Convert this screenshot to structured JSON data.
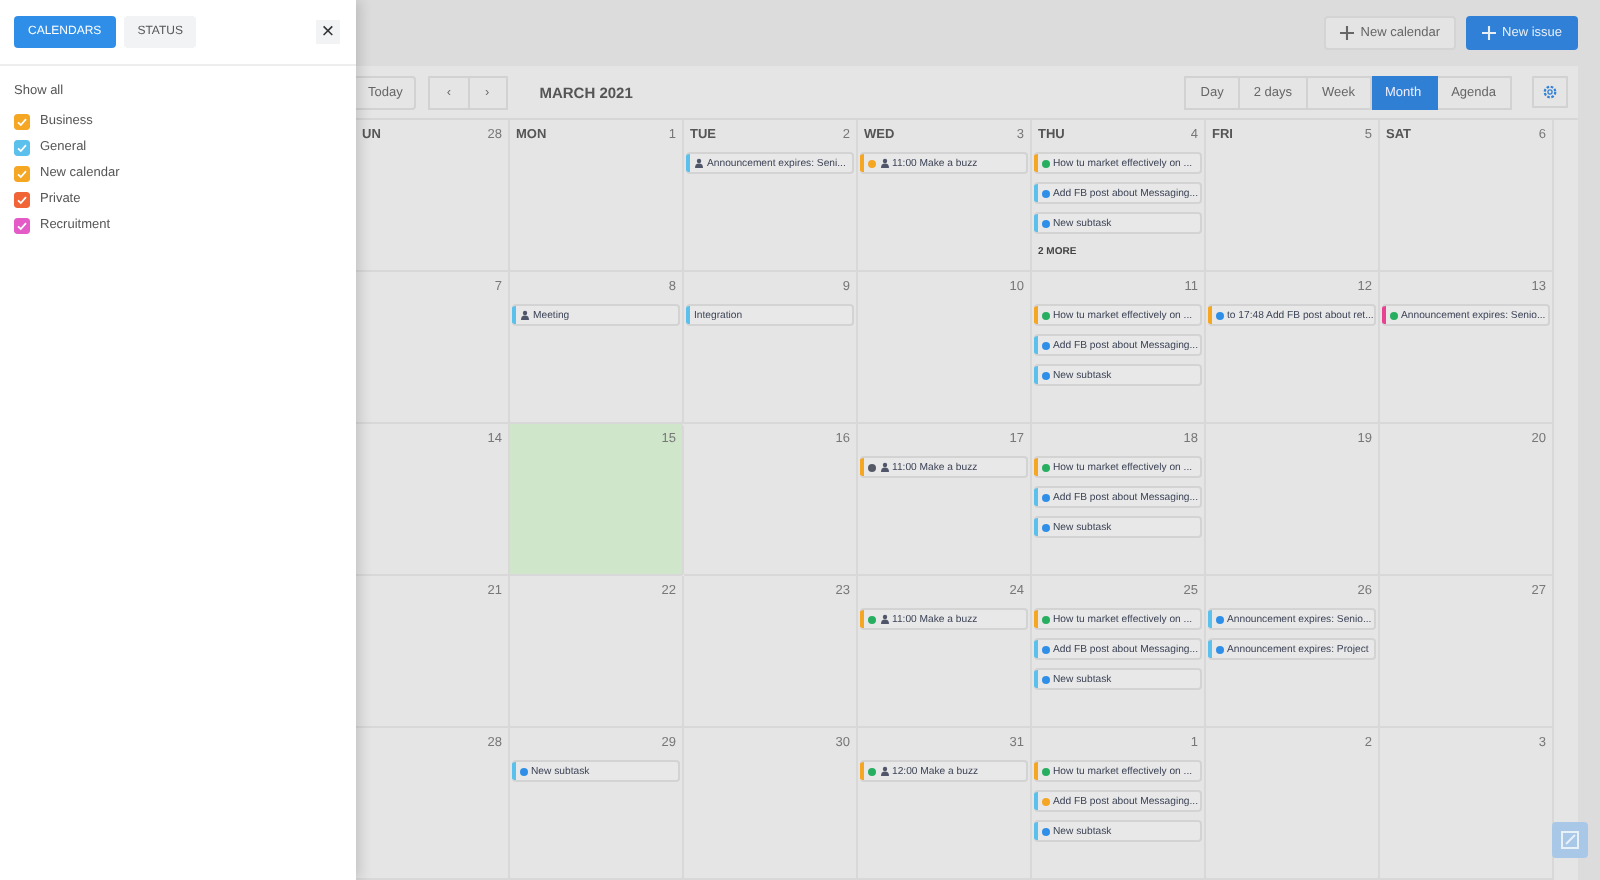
{
  "drawer": {
    "tabs": [
      {
        "label": "CALENDARS",
        "selected": true
      },
      {
        "label": "STATUS",
        "selected": false
      }
    ],
    "close": "×",
    "show_all": "Show all",
    "calendars": [
      {
        "name": "Business",
        "checked": true,
        "color": "#f5a623"
      },
      {
        "name": "General",
        "checked": true,
        "color": "#5bc0eb"
      },
      {
        "name": "New calendar",
        "checked": true,
        "color": "#f5a623"
      },
      {
        "name": "Private",
        "checked": true,
        "color": "#f06436"
      },
      {
        "name": "Recruitment",
        "checked": true,
        "color": "#e45bc8"
      }
    ]
  },
  "actions": [
    {
      "label": "New calendar",
      "kind": "secondary"
    },
    {
      "label": "New issue",
      "kind": "primary"
    }
  ],
  "toolbar": {
    "today": "Today",
    "prev": "‹",
    "next": "›",
    "month_title": "MARCH 2021",
    "views": [
      {
        "label": "Day",
        "selected": false
      },
      {
        "label": "2 days",
        "selected": false
      },
      {
        "label": "Week",
        "selected": false
      },
      {
        "label": "Month",
        "selected": true
      },
      {
        "label": "Agenda",
        "selected": false
      }
    ]
  },
  "weekdays": [
    "UN",
    "MON",
    "TUE",
    "WED",
    "THU",
    "FRI",
    "SAT"
  ],
  "weeks": [
    {
      "days": [
        {
          "number": "28",
          "today": false
        },
        {
          "number": "1",
          "today": false
        },
        {
          "number": "2",
          "today": false,
          "events": [
            {
              "text": "Announcement expires: Seni...",
              "color": "#5bc0eb",
              "person": true
            }
          ]
        },
        {
          "number": "3",
          "today": false,
          "events": [
            {
              "text": "11:00 Make a buzz",
              "color": "#f5a623",
              "dot": {
                "color": "#f5a623"
              },
              "person": true
            }
          ]
        },
        {
          "number": "4",
          "today": false,
          "more": "2 MORE",
          "events": [
            {
              "text": "How tu market effectively on ...",
              "color": "#f5a623",
              "dot": {
                "color": "#27ae60"
              },
              "person": false
            },
            {
              "text": "Add FB post about Messaging...",
              "color": "#5bc0eb",
              "dot": {
                "color": "#2f8fe8"
              },
              "person": false
            },
            {
              "text": "New subtask",
              "color": "#5bc0eb",
              "dot": {
                "color": "#2f8fe8"
              },
              "person": false
            }
          ]
        },
        {
          "number": "5",
          "today": false
        },
        {
          "number": "6",
          "today": false
        }
      ]
    },
    {
      "days": [
        {
          "number": "7",
          "today": false
        },
        {
          "number": "8",
          "today": false,
          "events": [
            {
              "text": "Meeting",
              "color": "#5bc0eb",
              "person": true
            }
          ]
        },
        {
          "number": "9",
          "today": false,
          "events": [
            {
              "text": "Integration",
              "color": "#5bc0eb",
              "person": false
            }
          ]
        },
        {
          "number": "10",
          "today": false
        },
        {
          "number": "11",
          "today": false,
          "events": [
            {
              "text": "How tu market effectively on ...",
              "color": "#f5a623",
              "dot": {
                "color": "#27ae60"
              },
              "person": false
            },
            {
              "text": "Add FB post about Messaging...",
              "color": "#5bc0eb",
              "dot": {
                "color": "#2f8fe8"
              },
              "person": false
            },
            {
              "text": "New subtask",
              "color": "#5bc0eb",
              "dot": {
                "color": "#2f8fe8"
              },
              "person": false
            }
          ]
        },
        {
          "number": "12",
          "today": false,
          "events": [
            {
              "text": "to 17:48  Add FB post about ret...",
              "color": "#f5a623",
              "dot": {
                "color": "#2f8fe8"
              },
              "person": false
            }
          ]
        },
        {
          "number": "13",
          "today": false,
          "events": [
            {
              "text": "Announcement expires: Senio...",
              "color": "#e84393",
              "dot": {
                "color": "#27ae60"
              },
              "person": false
            }
          ]
        }
      ]
    },
    {
      "days": [
        {
          "number": "14",
          "today": false
        },
        {
          "number": "15",
          "today": true
        },
        {
          "number": "16",
          "today": false
        },
        {
          "number": "17",
          "today": false,
          "events": [
            {
              "text": "11:00 Make a buzz",
              "color": "#f5a623",
              "dot": {
                "color": "#555a66"
              },
              "person": true
            }
          ]
        },
        {
          "number": "18",
          "today": false,
          "events": [
            {
              "text": "How tu market effectively on ...",
              "color": "#f5a623",
              "dot": {
                "color": "#27ae60"
              },
              "person": false
            },
            {
              "text": "Add FB post about Messaging...",
              "color": "#5bc0eb",
              "dot": {
                "color": "#2f8fe8"
              },
              "person": false
            },
            {
              "text": "New subtask",
              "color": "#5bc0eb",
              "dot": {
                "color": "#2f8fe8"
              },
              "person": false
            }
          ]
        },
        {
          "number": "19",
          "today": false
        },
        {
          "number": "20",
          "today": false
        }
      ]
    },
    {
      "days": [
        {
          "number": "21",
          "today": false
        },
        {
          "number": "22",
          "today": false
        },
        {
          "number": "23",
          "today": false
        },
        {
          "number": "24",
          "today": false,
          "events": [
            {
              "text": "11:00 Make a buzz",
              "color": "#f5a623",
              "dot": {
                "color": "#27ae60"
              },
              "person": true
            }
          ]
        },
        {
          "number": "25",
          "today": false,
          "events": [
            {
              "text": "How tu market effectively on ...",
              "color": "#f5a623",
              "dot": {
                "color": "#27ae60"
              },
              "person": false
            },
            {
              "text": "Add FB post about Messaging...",
              "color": "#5bc0eb",
              "dot": {
                "color": "#2f8fe8"
              },
              "person": false
            },
            {
              "text": "New subtask",
              "color": "#5bc0eb",
              "dot": {
                "color": "#2f8fe8"
              },
              "person": false
            }
          ]
        },
        {
          "number": "26",
          "today": false,
          "events": [
            {
              "text": "Announcement expires: Senio...",
              "color": "#5bc0eb",
              "dot": {
                "color": "#2f8fe8"
              },
              "person": false
            },
            {
              "text": "Announcement expires: Project",
              "color": "#5bc0eb",
              "dot": {
                "color": "#2f8fe8"
              },
              "person": false
            }
          ]
        },
        {
          "number": "27",
          "today": false
        }
      ]
    },
    {
      "days": [
        {
          "number": "28",
          "today": false
        },
        {
          "number": "29",
          "today": false,
          "events": [
            {
              "text": "New subtask",
              "color": "#5bc0eb",
              "dot": {
                "color": "#2f8fe8"
              },
              "person": false
            }
          ]
        },
        {
          "number": "30",
          "today": false
        },
        {
          "number": "31",
          "today": false,
          "events": [
            {
              "text": "12:00 Make a buzz",
              "color": "#f5a623",
              "dot": {
                "color": "#27ae60"
              },
              "person": true
            }
          ]
        },
        {
          "number": "1",
          "today": false,
          "events": [
            {
              "text": "How tu market effectively on ...",
              "color": "#f5a623",
              "dot": {
                "color": "#27ae60"
              },
              "person": false
            },
            {
              "text": "Add FB post about Messaging...",
              "color": "#5bc0eb",
              "dot": {
                "color": "#f5a623"
              },
              "person": false
            },
            {
              "text": "New subtask",
              "color": "#5bc0eb",
              "dot": {
                "color": "#2f8fe8"
              },
              "person": false
            }
          ]
        },
        {
          "number": "2",
          "today": false
        },
        {
          "number": "3",
          "today": false
        }
      ]
    }
  ]
}
